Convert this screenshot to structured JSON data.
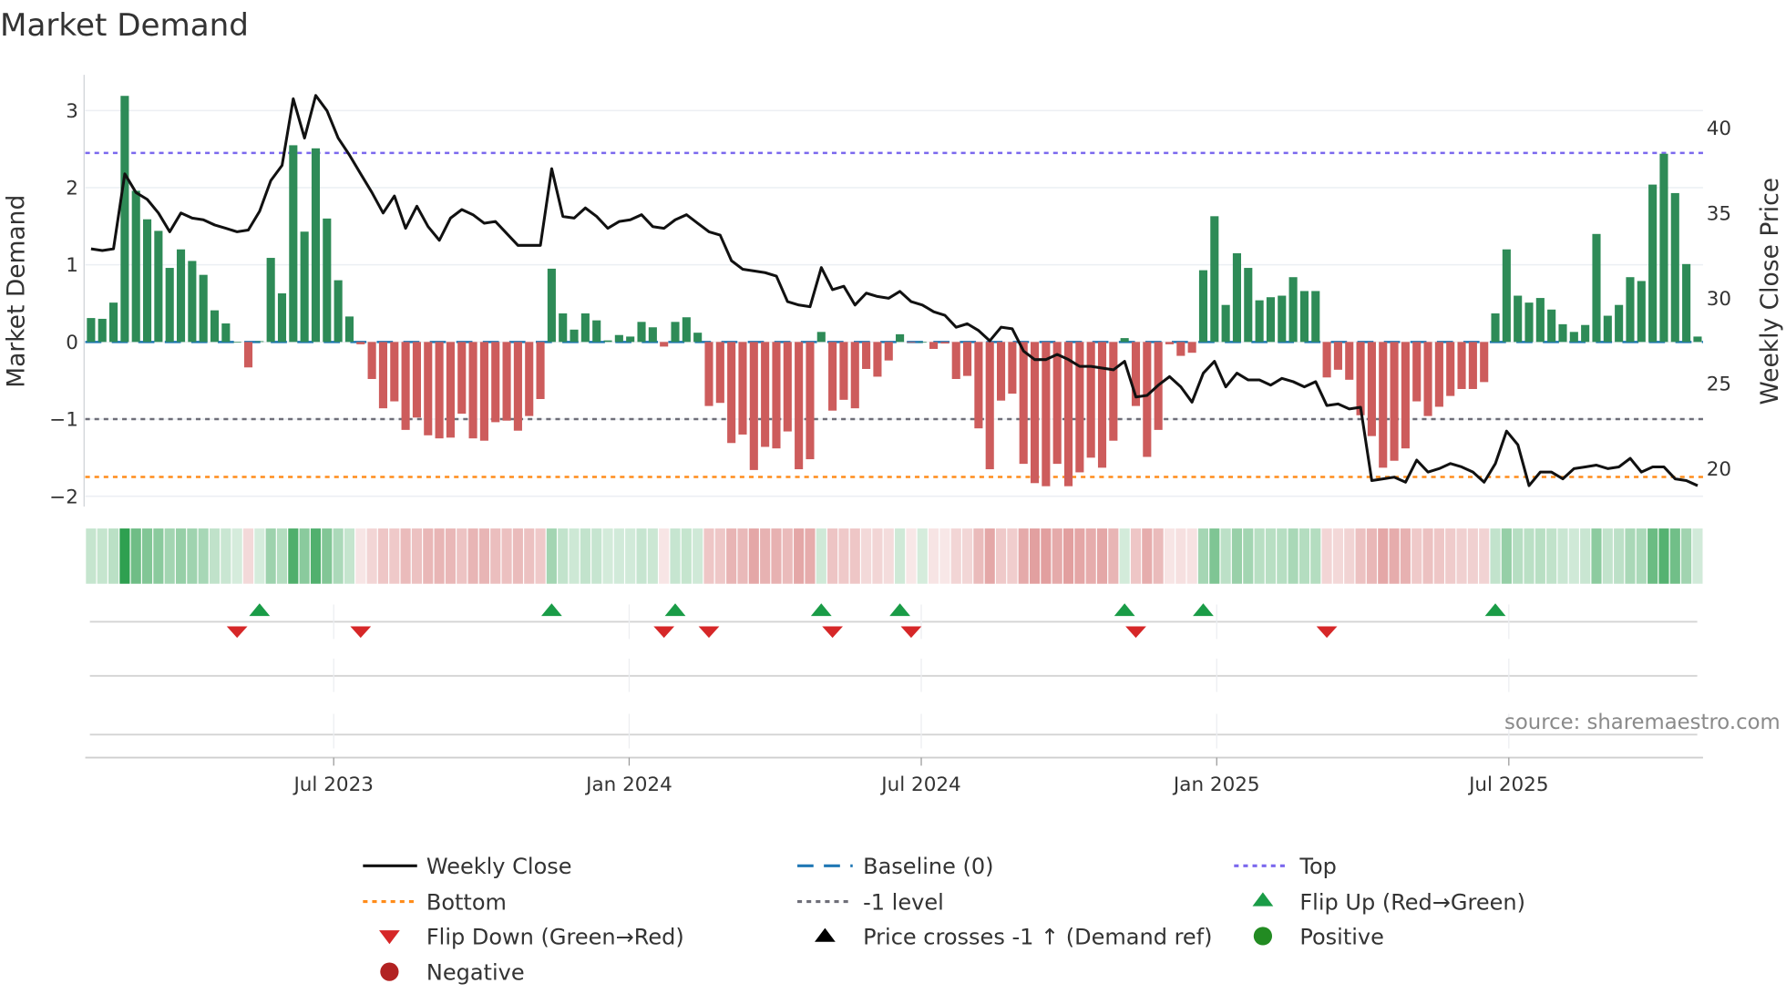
{
  "chart_data": {
    "type": "bar",
    "title": "Market Demand",
    "ylabel": "Market Demand",
    "y2label": "Weekly Close Price",
    "ylim": [
      -2.13,
      3.46
    ],
    "y2lim": [
      17.8,
      43.1
    ],
    "yticks": [
      3,
      2,
      1,
      0,
      -1,
      -2
    ],
    "ytick_labels": [
      "3",
      "2",
      "1",
      "0",
      "−1",
      "−2"
    ],
    "y2ticks": [
      40,
      35,
      30,
      25,
      20
    ],
    "y2tick_labels": [
      "40",
      "35",
      "30",
      "25",
      "20"
    ],
    "x_ticks": [
      {
        "label": "Jul 2023",
        "week": 21.6
      },
      {
        "label": "Jan 2024",
        "week": 47.9
      },
      {
        "label": "Jul 2024",
        "week": 73.9
      },
      {
        "label": "Jan 2025",
        "week": 100.2
      },
      {
        "label": "Jul 2025",
        "week": 126.2
      }
    ],
    "levels": {
      "top": 2.45,
      "bottom": -1.75,
      "minus_one": -1,
      "baseline": 0
    },
    "grid": true,
    "legend_position": "bottom",
    "demand": [
      0.31,
      0.3,
      0.51,
      3.19,
      1.96,
      1.59,
      1.44,
      0.96,
      1.2,
      1.05,
      0.87,
      0.41,
      0.24,
      0.0,
      -0.33,
      0.01,
      1.09,
      0.63,
      2.55,
      1.43,
      2.51,
      1.6,
      0.8,
      0.33,
      -0.03,
      -0.48,
      -0.86,
      -0.77,
      -1.14,
      -0.98,
      -1.21,
      -1.25,
      -1.24,
      -0.93,
      -1.25,
      -1.28,
      -1.04,
      -1.02,
      -1.15,
      -0.96,
      -0.74,
      0.95,
      0.37,
      0.16,
      0.37,
      0.28,
      0.02,
      0.09,
      0.07,
      0.26,
      0.19,
      -0.06,
      0.26,
      0.32,
      0.12,
      -0.83,
      -0.79,
      -1.31,
      -1.2,
      -1.66,
      -1.36,
      -1.38,
      -1.16,
      -1.65,
      -1.52,
      0.13,
      -0.89,
      -0.75,
      -0.86,
      -0.35,
      -0.45,
      -0.24,
      0.1,
      -0.01,
      0.0,
      -0.09,
      -0.02,
      -0.48,
      -0.44,
      -1.12,
      -1.65,
      -0.76,
      -0.67,
      -1.58,
      -1.83,
      -1.87,
      -1.58,
      -1.87,
      -1.69,
      -1.5,
      -1.63,
      -1.28,
      0.05,
      -0.83,
      -1.49,
      -1.14,
      -0.03,
      -0.18,
      -0.14,
      0.93,
      1.63,
      0.48,
      1.15,
      0.96,
      0.54,
      0.58,
      0.6,
      0.84,
      0.66,
      0.66,
      -0.46,
      -0.36,
      -0.49,
      -0.95,
      -1.22,
      -1.63,
      -1.54,
      -1.38,
      -0.77,
      -0.96,
      -0.84,
      -0.7,
      -0.61,
      -0.61,
      -0.52,
      0.37,
      1.2,
      0.6,
      0.51,
      0.57,
      0.42,
      0.23,
      0.13,
      0.22,
      1.4,
      0.34,
      0.48,
      0.84,
      0.79,
      2.04,
      2.44,
      1.93,
      1.01,
      0.07
    ],
    "weekly_close": [
      32.9,
      32.8,
      32.9,
      37.3,
      36.2,
      35.8,
      35.0,
      33.9,
      35.0,
      34.7,
      34.6,
      34.3,
      34.1,
      33.9,
      34.0,
      35.1,
      36.9,
      37.8,
      41.7,
      39.4,
      41.9,
      41.0,
      39.4,
      38.4,
      37.3,
      36.2,
      35.0,
      36.0,
      34.1,
      35.4,
      34.2,
      33.4,
      34.7,
      35.2,
      34.9,
      34.4,
      34.5,
      33.8,
      33.1,
      33.1,
      33.1,
      37.6,
      34.8,
      34.7,
      35.3,
      34.8,
      34.1,
      34.5,
      34.6,
      34.9,
      34.2,
      34.1,
      34.6,
      34.9,
      34.4,
      33.9,
      33.7,
      32.2,
      31.7,
      31.6,
      31.5,
      31.3,
      29.8,
      29.6,
      29.5,
      31.8,
      30.5,
      30.7,
      29.6,
      30.3,
      30.1,
      30.0,
      30.4,
      29.8,
      29.6,
      29.2,
      29.0,
      28.3,
      28.5,
      28.1,
      27.5,
      28.3,
      28.2,
      26.9,
      26.4,
      26.4,
      26.7,
      26.4,
      26.0,
      26.0,
      25.9,
      25.8,
      26.3,
      24.2,
      24.3,
      24.9,
      25.4,
      24.8,
      23.9,
      25.6,
      26.3,
      24.8,
      25.6,
      25.2,
      25.2,
      24.9,
      25.3,
      25.1,
      24.8,
      25.1,
      23.7,
      23.8,
      23.5,
      23.6,
      19.3,
      19.4,
      19.5,
      19.2,
      20.5,
      19.8,
      20.0,
      20.3,
      20.1,
      19.8,
      19.2,
      20.3,
      22.2,
      21.4,
      19.0,
      19.8,
      19.8,
      19.4,
      20.0,
      20.1,
      20.2,
      20.0,
      20.1,
      20.6,
      19.8,
      20.1,
      20.1,
      19.4,
      19.3,
      19.0
    ],
    "flip_up_weeks": [
      16,
      42,
      53,
      66,
      73,
      93,
      100,
      126
    ],
    "flip_down_weeks": [
      14,
      25,
      52,
      56,
      67,
      74,
      94,
      111
    ]
  },
  "colors": {
    "positive_bar": "#2e8b57",
    "negative_bar": "#cd5c5c",
    "price_line": "#111111",
    "baseline": "#1f77b4",
    "top": "#7b68ee",
    "bottom": "#ff8c1a",
    "minus_one": "#6e6e78",
    "flip_up": "#1a9c47",
    "flip_down": "#d62728",
    "price_cross": "#000000",
    "positive_dot": "#228b22",
    "negative_dot": "#b22222"
  },
  "source": "source: sharemaestro.com",
  "legend": {
    "weekly_close": "Weekly Close",
    "baseline": "Baseline (0)",
    "top": "Top",
    "bottom": "Bottom",
    "minus_one": "-1 level",
    "flip_up": "Flip Up (Red→Green)",
    "flip_down": "Flip Down (Green→Red)",
    "price_cross": "Price crosses -1 ↑ (Demand ref)",
    "positive": "Positive",
    "negative": "Negative"
  }
}
